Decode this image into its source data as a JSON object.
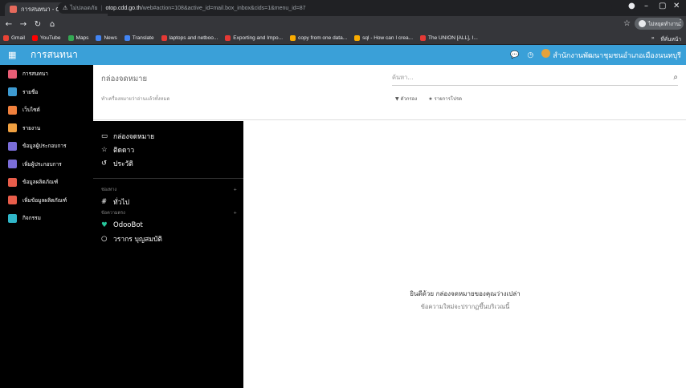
{
  "browser": {
    "tab_title": "การสนทนา - Odoo",
    "url_warning": "ไม่ปลอดภัย",
    "url_host": "otop.cdd.go.th",
    "url_path": "/web#action=108&active_id=mail.box_inbox&cids=1&menu_id=87",
    "profile_label": "ไม่หยุดทำงาน",
    "bookmarks": [
      {
        "label": "Gmail",
        "color": "#ea4335"
      },
      {
        "label": "YouTube",
        "color": "#ff0000"
      },
      {
        "label": "Maps",
        "color": "#34a853"
      },
      {
        "label": "News",
        "color": "#4285f4"
      },
      {
        "label": "Translate",
        "color": "#4285f4"
      },
      {
        "label": "laptops and netboo...",
        "color": "#e53935"
      },
      {
        "label": "Exporting and Impo...",
        "color": "#e53935"
      },
      {
        "label": "copy from one data...",
        "color": "#f9ab00"
      },
      {
        "label": "sql - How can I crea...",
        "color": "#f9ab00"
      },
      {
        "label": "The UNION [ALL], I...",
        "color": "#e53935"
      }
    ],
    "other_bookmarks": "ที่คั่นหน้า"
  },
  "odoo": {
    "app_title": "การสนทนา",
    "company": "สำนักงานพัฒนาชุมชนอำเภอเมืองนนทบุรี",
    "apps": [
      {
        "label": "การสนทนา",
        "color": "#e85d75"
      },
      {
        "label": "รายชื่อ",
        "color": "#3d9ad1"
      },
      {
        "label": "เว็บไซต์",
        "color": "#f0803c"
      },
      {
        "label": "รายงาน",
        "color": "#f0a040"
      },
      {
        "label": "ข้อมูลผู้ประกอบการ",
        "color": "#7a6dd8"
      },
      {
        "label": "เพิ่มผู้ประกอบการ",
        "color": "#7a6dd8"
      },
      {
        "label": "ข้อมูลผลิตภัณฑ์",
        "color": "#e85d4a"
      },
      {
        "label": "เพิ่มข้อมูลผลิตภัณฑ์",
        "color": "#e85d4a"
      },
      {
        "label": "กิจกรรม",
        "color": "#30b6c8"
      }
    ],
    "breadcrumb": "กล่องจดหมาย",
    "breadcrumb_sub": "ทำเครื่องหมายว่าอ่านแล้วทั้งหมด",
    "search_placeholder": "ค้นหา...",
    "filter_label": "ตัวกรอง",
    "favorites_label": "รายการโปรด",
    "mailboxes": [
      {
        "icon": "inbox-icon",
        "glyph": "▭",
        "label": "กล่องจดหมาย"
      },
      {
        "icon": "star-icon",
        "glyph": "☆",
        "label": "ติดดาว"
      },
      {
        "icon": "history-icon",
        "glyph": "↺",
        "label": "ประวัติ"
      }
    ],
    "channels_header": "ช่องทาง",
    "channels": [
      {
        "glyph": "#",
        "label": "ทั่วไป"
      }
    ],
    "direct_header": "ข้อความตรง",
    "direct": [
      {
        "glyph": "♥",
        "label": "OdooBot"
      },
      {
        "glyph": "○",
        "label": "วรากร บุญสมบัติ"
      }
    ],
    "empty_title": "ยินดีด้วย กล่องจดหมายของคุณว่างเปล่า",
    "empty_sub": "ข้อความใหม่จะปรากฏขึ้นบริเวณนี้"
  }
}
